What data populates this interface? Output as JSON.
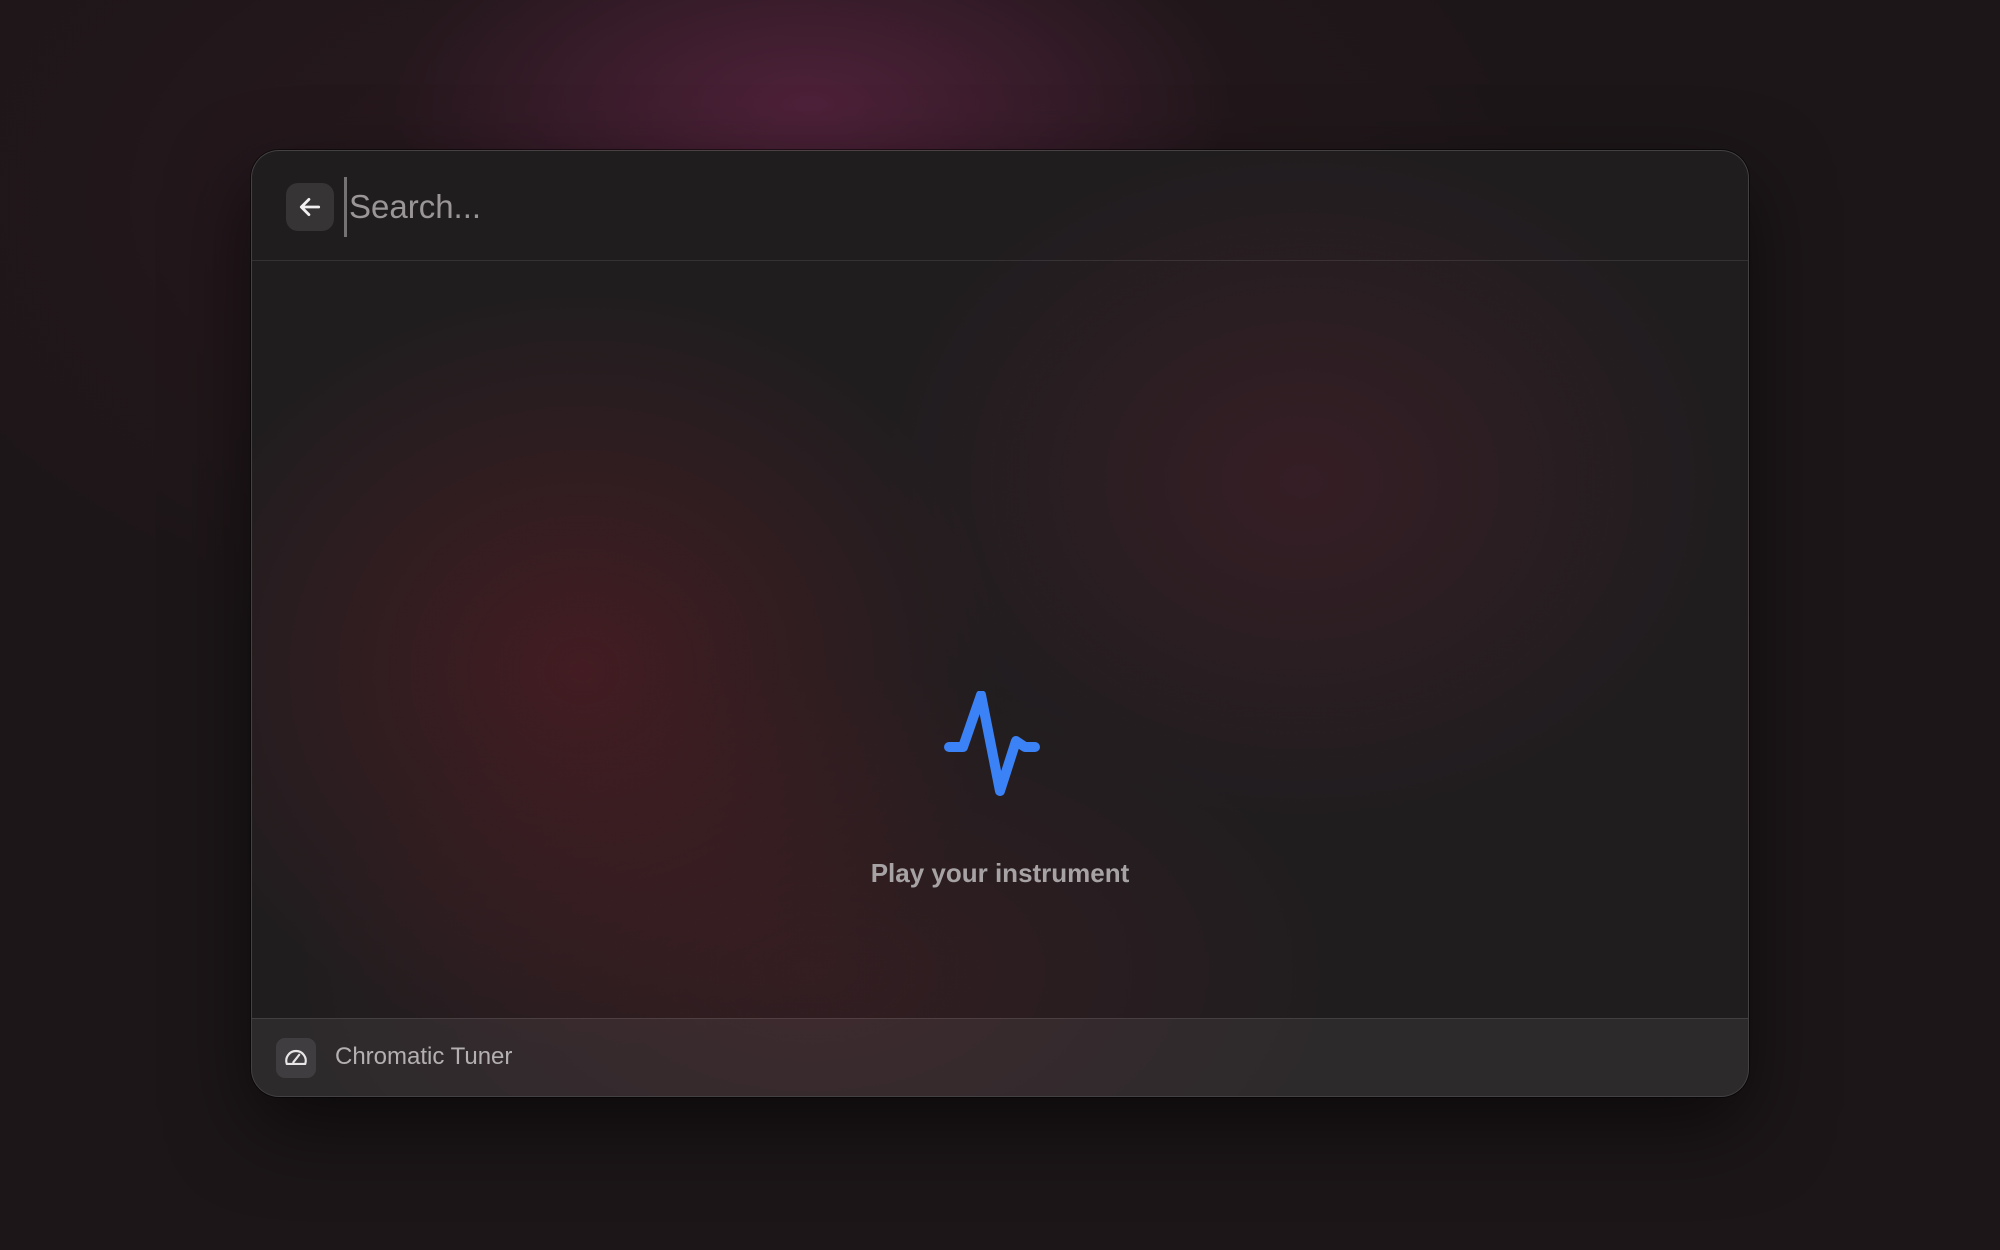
{
  "search": {
    "placeholder": "Search...",
    "back_icon": "arrow-left-icon"
  },
  "empty_state": {
    "icon": "waveform-pulse-icon",
    "icon_color": "#3b82f6",
    "message": "Play your instrument"
  },
  "action_bar": {
    "app_icon": "gauge-icon",
    "app_name": "Chromatic Tuner"
  }
}
